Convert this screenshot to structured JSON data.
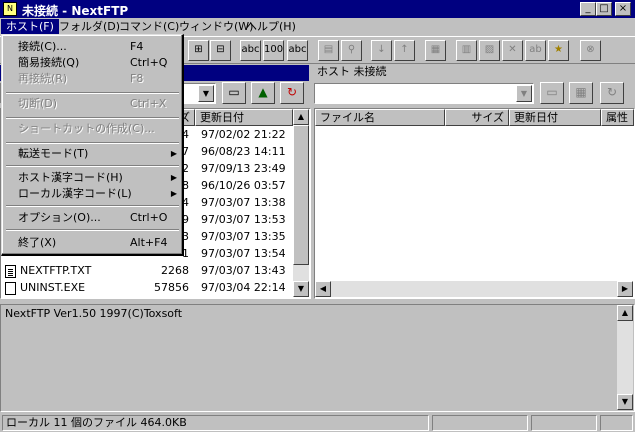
{
  "window": {
    "title": "未接続 - NextFTP",
    "minimize_glyph": "_",
    "maximize_glyph": "□",
    "close_glyph": "×"
  },
  "menubar": [
    {
      "label": "ホスト(F)"
    },
    {
      "label": "フォルダ(D)"
    },
    {
      "label": "コマンド(C)"
    },
    {
      "label": "ウィンドウ(W)"
    },
    {
      "label": "ヘルプ(H)"
    }
  ],
  "host_menu": {
    "items": [
      {
        "label": "接続(C)...",
        "shortcut": "F4",
        "disabled": false
      },
      {
        "label": "簡易接続(Q)",
        "shortcut": "Ctrl+Q",
        "disabled": false
      },
      {
        "label": "再接続(R)",
        "shortcut": "F8",
        "disabled": true
      },
      {
        "label": "切断(D)",
        "shortcut": "Ctrl+X",
        "disabled": true
      },
      {
        "label": "ショートカットの作成(C)...",
        "shortcut": "",
        "disabled": true
      },
      {
        "label": "転送モード(T)",
        "shortcut": "",
        "disabled": false,
        "submenu": true
      },
      {
        "label": "ホスト漢字コード(H)",
        "shortcut": "",
        "disabled": false,
        "submenu": true
      },
      {
        "label": "ローカル漢字コード(L)",
        "shortcut": "",
        "disabled": false,
        "submenu": true
      },
      {
        "label": "オプション(O)...",
        "shortcut": "Ctrl+O",
        "disabled": false
      },
      {
        "label": "終了(X)",
        "shortcut": "Alt+F4",
        "disabled": false
      }
    ],
    "submenu_glyph": "▶"
  },
  "toolbar": {
    "left_buttons": [
      "⊞",
      "⊟",
      "abc",
      "100",
      "abc"
    ],
    "right_buttons": [
      "▤",
      "⚲",
      "↓",
      "↑",
      "▦",
      "▥",
      "▨",
      "✕",
      "ab",
      "★",
      "⊗"
    ]
  },
  "remote_panel": {
    "host_label": "ホスト 未接続",
    "headers": {
      "name": "ファイル名",
      "size": "サイズ",
      "date": "更新日付",
      "attr": "属性"
    },
    "tool_glyphs": [
      "▭",
      "▦",
      "↻"
    ]
  },
  "local_panel": {
    "headers": {
      "size_tail": "ズ",
      "date": "更新日付"
    },
    "tool_glyphs": [
      "▭",
      "▲",
      "↻"
    ],
    "rows": [
      {
        "name": "",
        "size": "4",
        "date": "97/02/02 21:22",
        "icon": "file"
      },
      {
        "name": "",
        "size": "7",
        "date": "96/08/23 14:11",
        "icon": "file"
      },
      {
        "name": "",
        "size": "2",
        "date": "97/09/13 23:49",
        "icon": "file"
      },
      {
        "name": "",
        "size": "8",
        "date": "96/10/26 03:57",
        "icon": "file"
      },
      {
        "name": "",
        "size": "4",
        "date": "97/03/07 13:38",
        "icon": "file"
      },
      {
        "name": "",
        "size": "9",
        "date": "97/03/07 13:53",
        "icon": "file"
      },
      {
        "name": "",
        "size": "3",
        "date": "97/03/07 13:35",
        "icon": "file"
      },
      {
        "name": "",
        "size": "1",
        "date": "97/03/07 13:54",
        "icon": "file"
      },
      {
        "name": "NEXTFTP.TXT",
        "size": "2268",
        "date": "97/03/07 13:43",
        "icon": "file"
      },
      {
        "name": "UNINST.EXE",
        "size": "57856",
        "date": "97/03/04 22:14",
        "icon": "plain"
      }
    ]
  },
  "log": {
    "text": "NextFTP Ver1.50 1997(C)Toxsoft"
  },
  "status": {
    "text": "ローカル 11 個のファイル  464.0KB"
  },
  "scroll_glyphs": {
    "up": "▲",
    "down": "▼",
    "left": "◀",
    "right": "▶",
    "combo": "▼"
  }
}
